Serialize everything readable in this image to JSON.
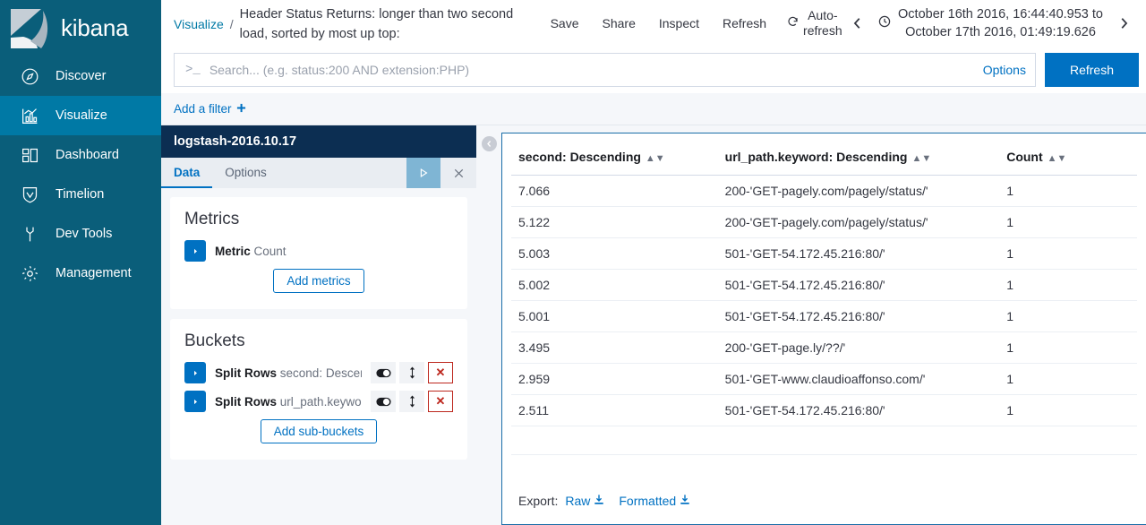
{
  "sidebar": {
    "brand": "kibana",
    "items": [
      {
        "label": "Discover",
        "icon": "compass-icon",
        "active": false
      },
      {
        "label": "Visualize",
        "icon": "bar-chart-icon",
        "active": true
      },
      {
        "label": "Dashboard",
        "icon": "dashboard-grid-icon",
        "active": false
      },
      {
        "label": "Timelion",
        "icon": "timelion-shield-icon",
        "active": false
      },
      {
        "label": "Dev Tools",
        "icon": "wrench-icon",
        "active": false
      },
      {
        "label": "Management",
        "icon": "gear-icon",
        "active": false
      }
    ]
  },
  "topbar": {
    "breadcrumb_root": "Visualize",
    "breadcrumb_separator": "/",
    "breadcrumb_title": "Header Status Returns: longer than two second load, sorted by most up top:",
    "save_label": "Save",
    "share_label": "Share",
    "inspect_label": "Inspect",
    "refresh_label": "Refresh",
    "autorefresh_label": "Auto-refresh",
    "time_range": "October 16th 2016, 16:44:40.953 to October 17th 2016, 01:49:19.626",
    "time_range_line1": "October 16th 2016, 16:44:40.953 to",
    "time_range_line2": "October 17th 2016, 01:49:19.626"
  },
  "query": {
    "prompt": ">_",
    "value": "",
    "placeholder": "Search... (e.g. status:200 AND extension:PHP)",
    "options_label": "Options",
    "refresh_label": "Refresh"
  },
  "filters": {
    "add_filter_label": "Add a filter"
  },
  "editor": {
    "index_title": "logstash-2016.10.17",
    "tabs": [
      {
        "label": "Data",
        "active": true
      },
      {
        "label": "Options",
        "active": false
      }
    ],
    "metrics": {
      "heading": "Metrics",
      "rows": [
        {
          "type": "Metric",
          "value": "Count"
        }
      ],
      "add_label": "Add metrics"
    },
    "buckets": {
      "heading": "Buckets",
      "rows": [
        {
          "type": "Split Rows",
          "value": "second: Descendi..."
        },
        {
          "type": "Split Rows",
          "value": "url_path.keyword:..."
        }
      ],
      "add_label": "Add sub-buckets"
    }
  },
  "chart_data": {
    "type": "table",
    "title": "Header Status Returns: longer than two second load, sorted by most up top:",
    "columns": [
      "second: Descending",
      "url_path.keyword: Descending",
      "Count"
    ],
    "rows": [
      [
        "7.066",
        "200-'GET-pagely.com/pagely/status/'",
        "1"
      ],
      [
        "5.122",
        "200-'GET-pagely.com/pagely/status/'",
        "1"
      ],
      [
        "5.003",
        "501-'GET-54.172.45.216:80/'",
        "1"
      ],
      [
        "5.002",
        "501-'GET-54.172.45.216:80/'",
        "1"
      ],
      [
        "5.001",
        "501-'GET-54.172.45.216:80/'",
        "1"
      ],
      [
        "3.495",
        "200-'GET-page.ly/??/'",
        "1"
      ],
      [
        "2.959",
        "501-'GET-www.claudioaffonso.com/'",
        "1"
      ],
      [
        "2.511",
        "501-'GET-54.172.45.216:80/'",
        "1"
      ]
    ]
  },
  "export": {
    "label": "Export:",
    "raw_label": "Raw",
    "formatted_label": "Formatted"
  },
  "colors": {
    "sidebar_bg": "#0a5e7a",
    "sidebar_active": "#0079a5",
    "accent_blue": "#0071c2",
    "link_blue": "#0079a5",
    "editor_title_bg": "#0c2e52",
    "danger_red": "#bd271e",
    "page_bg": "#f5f7fa"
  }
}
